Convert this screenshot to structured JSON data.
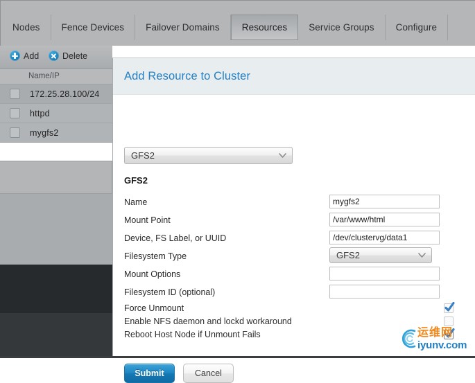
{
  "tabs": [
    {
      "label": "Nodes",
      "active": false
    },
    {
      "label": "Fence Devices",
      "active": false
    },
    {
      "label": "Failover Domains",
      "active": false
    },
    {
      "label": "Resources",
      "active": true
    },
    {
      "label": "Service Groups",
      "active": false
    },
    {
      "label": "Configure",
      "active": false
    }
  ],
  "toolbar": {
    "add_label": "Add",
    "add_icon": "plus-circle-icon",
    "delete_label": "Delete",
    "delete_icon": "x-circle-icon"
  },
  "resource_list": {
    "column_header": "Name/IP",
    "rows": [
      {
        "name": "172.25.28.100/24",
        "checked": false
      },
      {
        "name": "httpd",
        "checked": false
      },
      {
        "name": "mygfs2",
        "checked": false
      }
    ]
  },
  "dialog": {
    "title": "Add Resource to Cluster",
    "resource_type": {
      "selected": "GFS2",
      "options": [
        "GFS2"
      ]
    },
    "section_title": "GFS2",
    "fields": [
      {
        "label": "Name",
        "value": "mygfs2",
        "placeholder": ""
      },
      {
        "label": "Mount Point",
        "value": "/var/www/html",
        "placeholder": ""
      },
      {
        "label": "Device, FS Label, or UUID",
        "value": "/dev/clustervg/data1",
        "placeholder": ""
      }
    ],
    "filesystem_type": {
      "label": "Filesystem Type",
      "selected": "GFS2",
      "options": [
        "GFS2"
      ]
    },
    "fields2": [
      {
        "label": "Mount Options",
        "value": "",
        "placeholder": ""
      },
      {
        "label": "Filesystem ID (optional)",
        "value": "",
        "placeholder": ""
      }
    ],
    "checkboxes": [
      {
        "label": "Force Unmount",
        "checked": true,
        "focused": false
      },
      {
        "label": "Enable NFS daemon and lockd workaround",
        "checked": false,
        "focused": false
      },
      {
        "label": "Reboot Host Node if Unmount Fails",
        "checked": true,
        "focused": true
      }
    ],
    "submit_label": "Submit",
    "cancel_label": "Cancel"
  },
  "watermark": {
    "cn_text": "运维网",
    "en_text": "iyunv.com",
    "icon": "ring-swoosh-logo-icon",
    "cn_color": "#f08a1e",
    "en_color": "#1f7fc4"
  },
  "colors": {
    "accent_blue": "#2480c4",
    "dialog_header_bg": "#e8edf0",
    "page_bg": "#b4b6b8"
  }
}
